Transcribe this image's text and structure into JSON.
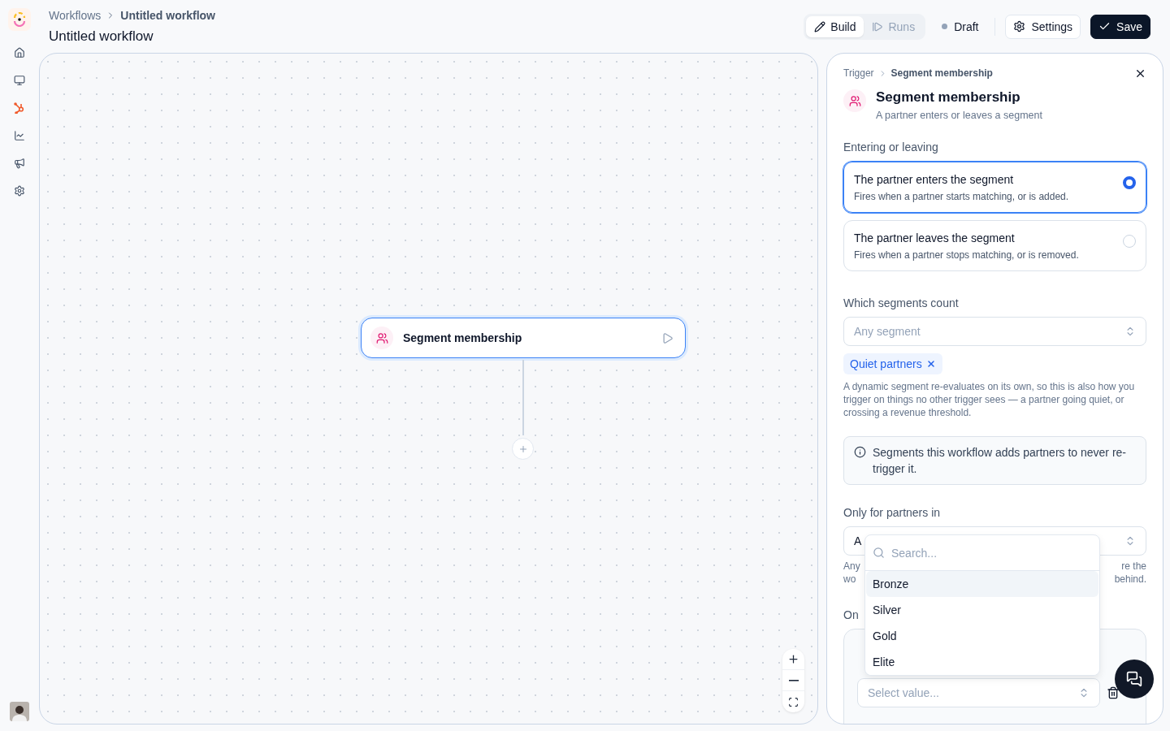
{
  "breadcrumb": [
    {
      "label": "Workflows",
      "current": false
    },
    {
      "label": "Untitled workflow",
      "current": true
    }
  ],
  "title": "Untitled workflow",
  "mode_tabs": [
    {
      "label": "Build",
      "kind": "build",
      "selected": true
    },
    {
      "label": "Runs",
      "kind": "runs",
      "selected": false
    }
  ],
  "status": {
    "label": "Draft"
  },
  "buttons": {
    "settings": "Settings",
    "save": "Save"
  },
  "canvas": {
    "node": {
      "title": "Segment membership"
    }
  },
  "panel": {
    "breadcrumb": [
      {
        "label": "Trigger",
        "current": false
      },
      {
        "label": "Segment membership",
        "current": true
      }
    ],
    "title": "Segment membership",
    "subtitle": "A partner enters or leaves a segment",
    "entering": {
      "label": "Entering or leaving",
      "options": [
        {
          "title": "The partner enters the segment",
          "description": "Fires when a partner starts matching, or is added.",
          "selected": true
        },
        {
          "title": "The partner leaves the segment",
          "description": "Fires when a partner stops matching, or is removed.",
          "selected": false
        }
      ]
    },
    "segments": {
      "label": "Which segments count",
      "placeholder": "Any segment",
      "chips": [
        {
          "label": "Quiet partners"
        }
      ],
      "help": "A dynamic segment re-evaluates on its own, so this is also how you trigger on things no other trigger sees — a partner going quiet, or crossing a revenue threshold."
    },
    "info": "Segments this workflow adds partners to never re-trigger it.",
    "partners_in": {
      "label": "Only for partners in",
      "value": "A",
      "help_left": [
        "Any",
        "wo"
      ],
      "help_right": [
        "re the",
        "behind."
      ]
    },
    "next_label": "On",
    "condition": {
      "placeholder": "Select value..."
    }
  },
  "dropdown": {
    "placeholder": "Search...",
    "options": [
      {
        "label": "Bronze",
        "selected": true
      },
      {
        "label": "Silver",
        "selected": false
      },
      {
        "label": "Gold",
        "selected": false
      },
      {
        "label": "Elite",
        "selected": false
      }
    ]
  }
}
